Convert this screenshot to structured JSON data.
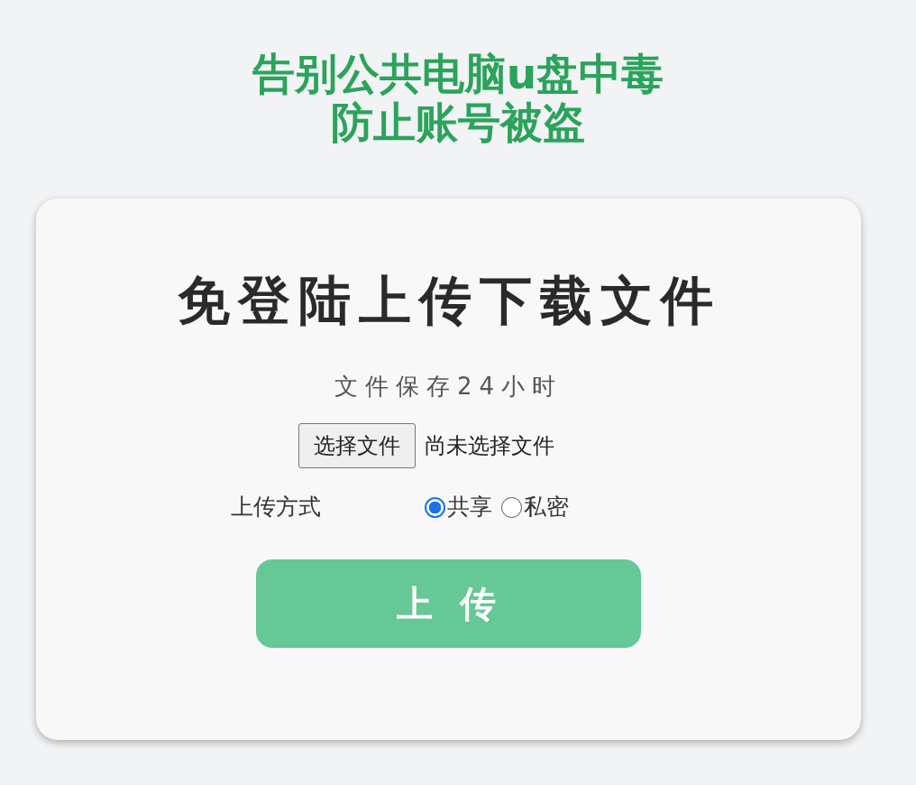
{
  "header": {
    "lines": [
      "告别公共电脑u盘中毒",
      "防止账号被盗"
    ]
  },
  "card": {
    "title": "免登陆上传下载文件",
    "subtitle": "文件保存24小时",
    "file_picker": {
      "button": "选择文件",
      "status": "尚未选择文件"
    },
    "upload_mode": {
      "label": "上传方式",
      "options": [
        {
          "label": "共享",
          "selected": true
        },
        {
          "label": "私密",
          "selected": false
        }
      ]
    },
    "submit": "上传"
  }
}
